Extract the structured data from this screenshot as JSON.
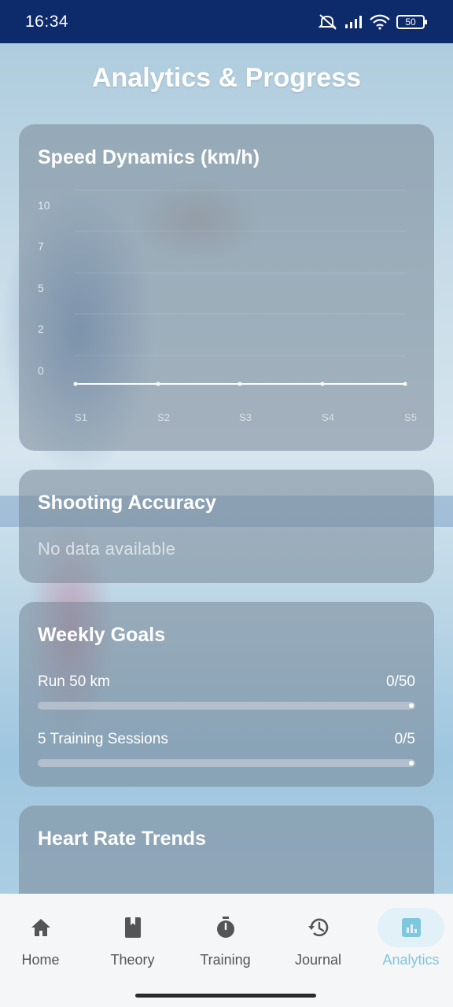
{
  "status_bar": {
    "time": "16:34",
    "battery": "50"
  },
  "page": {
    "title": "Analytics & Progress"
  },
  "speed_card": {
    "title": "Speed Dynamics (km/h)",
    "chart_data": {
      "type": "line",
      "title": "Speed Dynamics (km/h)",
      "categories": [
        "S1",
        "S2",
        "S3",
        "S4",
        "S5"
      ],
      "y_ticks": [
        "10",
        "7",
        "5",
        "2",
        "0"
      ],
      "series": [
        {
          "values": [
            0,
            0,
            0,
            0,
            0
          ]
        }
      ],
      "ylim": [
        0,
        10
      ],
      "grid": true,
      "color": "#ffffff"
    }
  },
  "shooting_card": {
    "title": "Shooting Accuracy",
    "empty_text": "No data available"
  },
  "goals_card": {
    "title": "Weekly Goals",
    "goals": [
      {
        "label": "Run 50 km",
        "value": "0/50",
        "progress": 0
      },
      {
        "label": "5 Training Sessions",
        "value": "0/5",
        "progress": 0
      }
    ]
  },
  "heart_card": {
    "title": "Heart Rate Trends"
  },
  "nav": {
    "items": [
      {
        "label": "Home",
        "icon": "home-icon"
      },
      {
        "label": "Theory",
        "icon": "book-icon"
      },
      {
        "label": "Training",
        "icon": "stopwatch-icon"
      },
      {
        "label": "Journal",
        "icon": "history-icon"
      },
      {
        "label": "Analytics",
        "icon": "analytics-icon",
        "active": true
      }
    ],
    "active_color": "#7ec7df"
  }
}
